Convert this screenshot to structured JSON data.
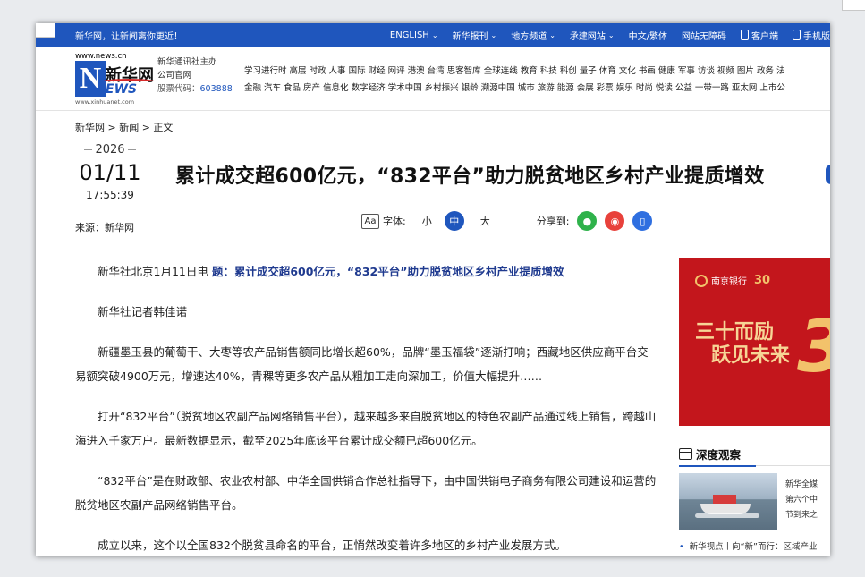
{
  "topbar": {
    "slogan": "新华网，让新闻离你更近！",
    "nav": [
      {
        "label": "ENGLISH",
        "chevron": true
      },
      {
        "label": "新华报刊",
        "chevron": true
      },
      {
        "label": "地方频道",
        "chevron": true
      },
      {
        "label": "承建网站",
        "chevron": true
      },
      {
        "label": "中文/繁体",
        "chevron": false
      },
      {
        "label": "网站无障碍",
        "chevron": false
      },
      {
        "label": "客户端",
        "icon": "qr-code-icon"
      },
      {
        "label": "手机版",
        "icon": "mobile-phone-icon"
      }
    ]
  },
  "logo": {
    "url_top": "www.news.cn",
    "brand": "新华网",
    "brand_n": "N",
    "brand_ews": "EWS",
    "url_bottom": "www.xinhuanet.com"
  },
  "company": {
    "line1": "新华通讯社主办",
    "line2": "公司官网",
    "stock_label": "股票代码：",
    "stock_code": "603888"
  },
  "channels": {
    "row1": "学习进行时 高层 时政 人事 国际 财经 网评 港澳 台湾 思客智库 全球连线 教育 科技 科创 量子 体育 文化 书画 健康 军事 访谈 视频 图片 政务 法",
    "row2": "金融 汽车 食品 房产 信息化 数字经济 学术中国 乡村振兴 银龄 溯源中国 城市 旅游 能源 会展 彩票 娱乐 时尚 悦读 公益 一带一路 亚太网 上市公"
  },
  "breadcrumb": "新华网 > 新闻 > 正文",
  "article": {
    "year": "2026",
    "month_day": "01/11",
    "time": "17:55:39",
    "source": "来源：新华网",
    "title": "累计成交超600亿元，“832平台”助力脱贫地区乡村产业提质增效",
    "font_label": "字体:",
    "font_small": "小",
    "font_medium": "中",
    "font_large": "大",
    "share_label": "分享到:",
    "lead_prefix": "新华社北京1月11日电 ",
    "lead_title": "题：累计成交超600亿元，“832平台”助力脱贫地区乡村产业提质增效",
    "paragraphs": [
      "新华社记者韩佳诺",
      "新疆墨玉县的葡萄干、大枣等农产品销售额同比增长超60%，品牌“墨玉福袋”逐渐打响；西藏地区供应商平台交易额突破4900万元，增速达40%，青稞等更多农产品从粗加工走向深加工，价值大幅提升……",
      "打开“832平台”（脱贫地区农副产品网络销售平台），越来越多来自脱贫地区的特色农副产品通过线上销售，跨越山海进入千家万户。最新数据显示，截至2025年底该平台累计成交额已超600亿元。",
      "“832平台”是在财政部、农业农村部、中华全国供销合作总社指导下，由中国供销电子商务有限公司建设和运营的脱贫地区农副产品网络销售平台。",
      "成立以来，这个以全国832个脱贫县命名的平台，正悄然改变着许多地区的乡村产业发展方式。"
    ]
  },
  "ad": {
    "bank": "南京银行",
    "anniversary": "30",
    "slogan_line1": "三十而励",
    "slogan_line2": "跃见未来",
    "big_char": "3"
  },
  "sidebar": {
    "section_title": "深度观察",
    "news_lines": [
      "新华全媒",
      "第六个中",
      "节到来之"
    ],
    "bullet": "新华视点丨向“新”而行：区域产业"
  },
  "colors": {
    "brand_blue": "#1f56bd",
    "ad_red": "#c3161c",
    "wechat_green": "#2fb24b",
    "weibo_red": "#e8413b",
    "phone_blue": "#2f6fe0"
  }
}
